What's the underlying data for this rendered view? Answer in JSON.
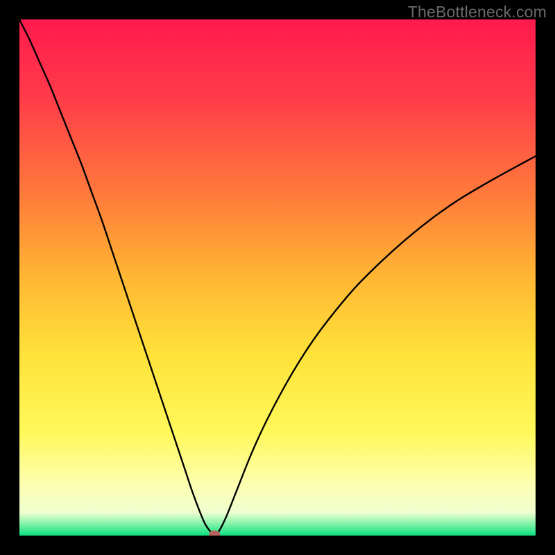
{
  "watermark": "TheBottleneck.com",
  "chart_data": {
    "type": "line",
    "title": "",
    "xlabel": "",
    "ylabel": "",
    "xlim": [
      0,
      100
    ],
    "ylim": [
      0,
      100
    ],
    "background_gradient": {
      "stops": [
        {
          "offset": 0.0,
          "color": "#ff1a4d"
        },
        {
          "offset": 0.15,
          "color": "#ff3b4a"
        },
        {
          "offset": 0.35,
          "color": "#ff7e3a"
        },
        {
          "offset": 0.5,
          "color": "#ffb733"
        },
        {
          "offset": 0.65,
          "color": "#ffe23a"
        },
        {
          "offset": 0.8,
          "color": "#fff95a"
        },
        {
          "offset": 0.9,
          "color": "#fdffb0"
        },
        {
          "offset": 0.955,
          "color": "#f0ffd0"
        },
        {
          "offset": 0.975,
          "color": "#8ff5ae"
        },
        {
          "offset": 1.0,
          "color": "#09e07e"
        }
      ]
    },
    "series": [
      {
        "name": "bottleneck-curve",
        "color": "#000000",
        "x": [
          0,
          2,
          4,
          6,
          8,
          10,
          12,
          14,
          16,
          18,
          20,
          22,
          24,
          26,
          28,
          30,
          32,
          33.5,
          35,
          36,
          37,
          37.8,
          38.5,
          40,
          42,
          45,
          48,
          52,
          56,
          60,
          65,
          70,
          75,
          80,
          85,
          90,
          95,
          100
        ],
        "y": [
          100,
          96,
          91.5,
          87,
          82,
          77,
          72,
          66.5,
          61,
          55,
          49,
          43,
          37,
          31,
          25,
          19,
          13,
          8.5,
          4.5,
          2.2,
          0.8,
          0.2,
          0.6,
          3.5,
          8.5,
          16,
          22.5,
          30,
          36.5,
          42,
          48,
          53,
          57.5,
          61.5,
          65,
          68,
          70.8,
          73.5
        ]
      }
    ],
    "marker": {
      "name": "optimum-point",
      "x": 37.8,
      "y": 0.2,
      "color": "#b9625c",
      "rx": 8,
      "ry": 6
    }
  }
}
